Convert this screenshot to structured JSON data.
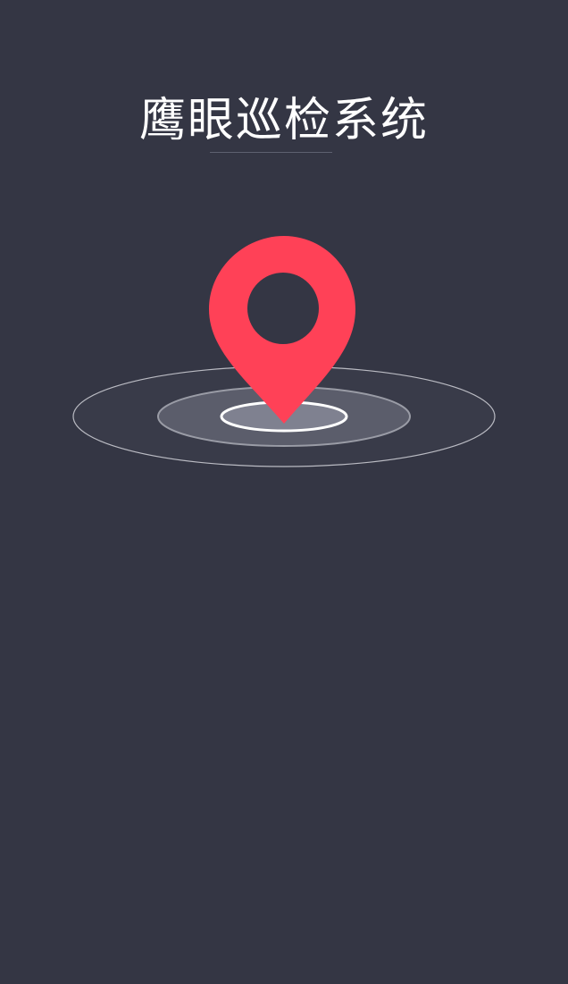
{
  "app": {
    "title": "鹰眼巡检系统"
  },
  "colors": {
    "background": "#343644",
    "pin": "#ff4157",
    "ring_stroke": "#c9cad1",
    "inner_ring_stroke": "#ffffff",
    "title_text": "#ffffff",
    "underline": "#5e6170"
  },
  "icons": {
    "splash_graphic": "location-pin-icon"
  }
}
